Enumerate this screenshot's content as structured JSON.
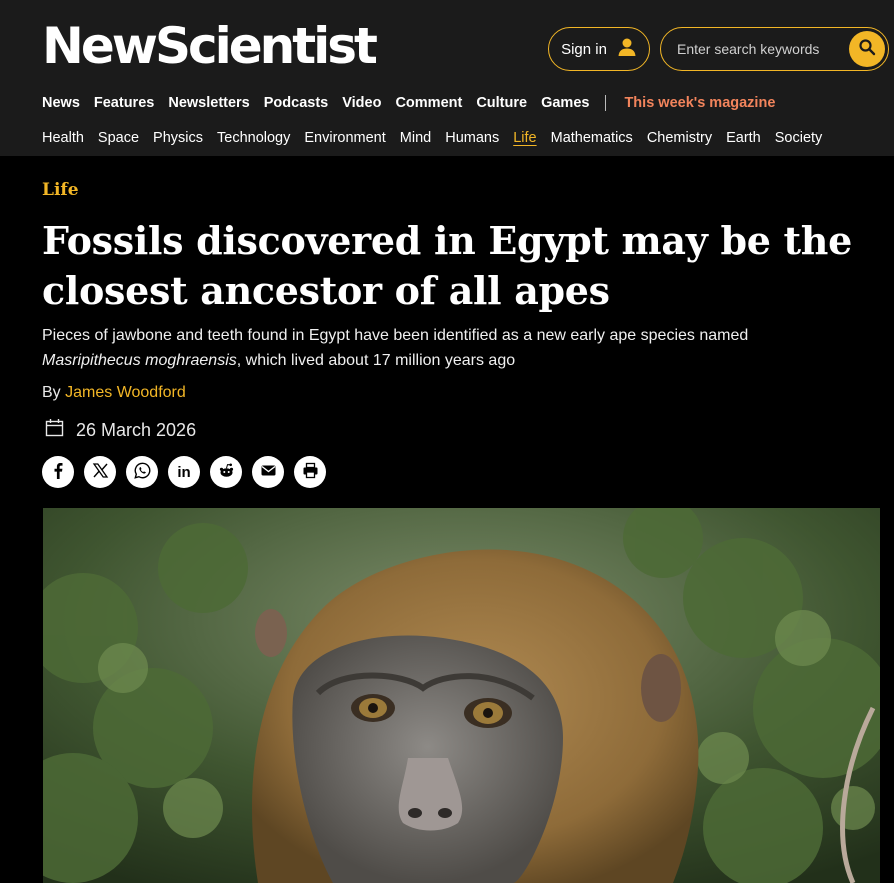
{
  "site": {
    "logo_text": "NewScientist"
  },
  "header": {
    "signin_label": "Sign in",
    "search_placeholder": "Enter search keywords"
  },
  "nav": {
    "primary": [
      "News",
      "Features",
      "Newsletters",
      "Podcasts",
      "Video",
      "Comment",
      "Culture",
      "Games"
    ],
    "magazine": "This week's magazine",
    "topics": [
      "Health",
      "Space",
      "Physics",
      "Technology",
      "Environment",
      "Mind",
      "Humans",
      "Life",
      "Mathematics",
      "Chemistry",
      "Earth",
      "Society"
    ],
    "active_topic": "Life"
  },
  "article": {
    "section": "Life",
    "headline": "Fossils discovered in Egypt may be the closest ancestor of all apes",
    "standfirst_1": "Pieces of jawbone and teeth found in Egypt have been identified as a new early ape species named",
    "standfirst_species": "Masripithecus moghraensis",
    "standfirst_2": ", which lived about 17 million years ago",
    "byline_prefix": "By",
    "author": "James Woodford",
    "date": "26 March 2026"
  },
  "share_icons": [
    "facebook-icon",
    "x-icon",
    "whatsapp-icon",
    "linkedin-icon",
    "reddit-icon",
    "email-icon",
    "print-icon"
  ],
  "colors": {
    "accent": "#f2b626",
    "magazine_link": "#f2845c",
    "header_bg": "#1b1b1b",
    "page_bg": "#000000"
  }
}
